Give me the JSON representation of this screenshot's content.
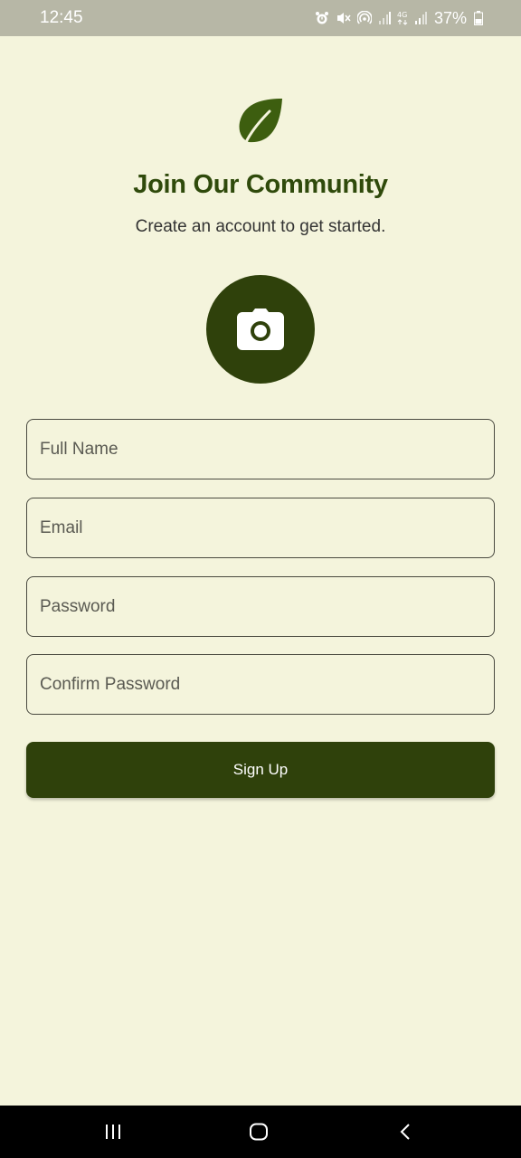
{
  "status_bar": {
    "time": "12:45",
    "battery": "37%",
    "icons": [
      "alarm-icon",
      "mute-icon",
      "hotspot-icon",
      "signal-icon",
      "4g-icon",
      "signal-icon",
      "battery-icon"
    ]
  },
  "header": {
    "logo_icon": "leaf-icon",
    "title": "Join Our Community",
    "subtitle": "Create an account to get started."
  },
  "avatar": {
    "icon": "camera-icon"
  },
  "form": {
    "full_name_placeholder": "Full Name",
    "email_placeholder": "Email",
    "password_placeholder": "Password",
    "confirm_password_placeholder": "Confirm Password",
    "submit_label": "Sign Up"
  },
  "nav_bar": {
    "icons": [
      "recent-apps-icon",
      "home-icon",
      "back-icon"
    ]
  },
  "colors": {
    "background": "#f4f4dc",
    "primary": "#2f410b",
    "title": "#2f4a0b",
    "logo": "#3d5e0f"
  }
}
